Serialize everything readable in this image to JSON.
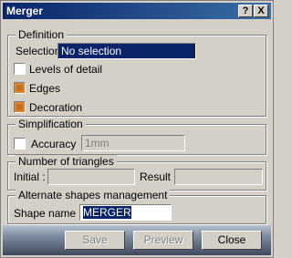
{
  "window": {
    "title": "Merger",
    "help_label": "?",
    "close_label": "X"
  },
  "definition": {
    "legend": "Definition",
    "selection_label": "Selection",
    "selection_value": "No selection",
    "levels_of_detail_label": "Levels of detail",
    "levels_of_detail_checked": false,
    "edges_label": "Edges",
    "edges_checked": true,
    "decoration_label": "Decoration",
    "decoration_checked": true
  },
  "simplification": {
    "legend": "Simplification",
    "accuracy_label": "Accuracy",
    "accuracy_checked": false,
    "accuracy_value": "1mm"
  },
  "triangles": {
    "legend": "Number of triangles",
    "initial_label": "Initial :",
    "initial_value": "",
    "result_label": "Result :",
    "result_value": ""
  },
  "alternate_shapes": {
    "legend": "Alternate shapes management",
    "shape_name_label": "Shape name :",
    "shape_name_value": "MERGER"
  },
  "buttons": {
    "save_label": "Save",
    "preview_label": "Preview",
    "close_label": "Close"
  }
}
